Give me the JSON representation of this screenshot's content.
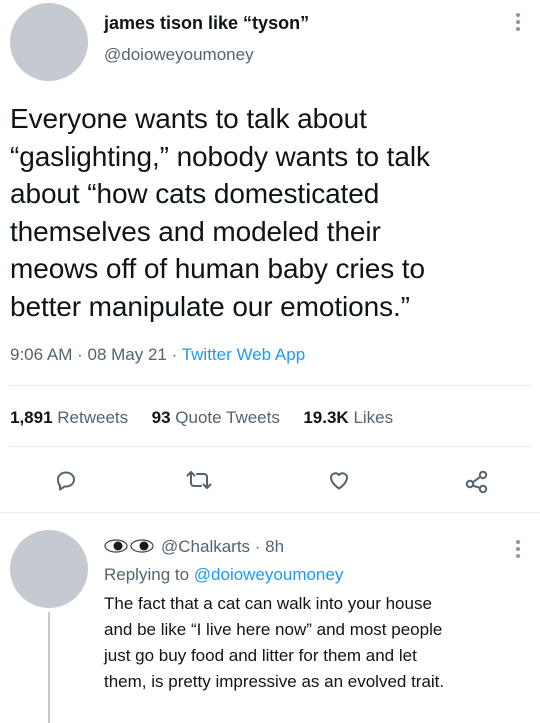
{
  "tweet": {
    "author_name": "james tison like “tyson”",
    "author_handle": "@doioweyoumoney",
    "text_lines": [
      "Everyone wants to talk about",
      "“gaslighting,” nobody wants to talk",
      "about “how cats domesticated",
      "themselves and modeled their",
      "meows off of human baby cries to",
      "better manipulate our emotions.”"
    ],
    "time": "9:06 AM",
    "date": "08 May 21",
    "app": "Twitter Web App",
    "separator": " · "
  },
  "stats": {
    "retweets_count": "1,891",
    "retweets_label": "Retweets",
    "quote_count": "93",
    "quote_label": "Quote Tweets",
    "likes_count": "19.3K",
    "likes_label": "Likes"
  },
  "actions": {
    "icons": [
      "reply-icon",
      "retweet-icon",
      "like-icon",
      "share-icon"
    ]
  },
  "reply": {
    "author_handle": "@Chalkarts",
    "age": " · 8h",
    "replying_prefix": "Replying to ",
    "replying_to": "@doioweyoumoney",
    "text_lines": [
      "The fact that a cat can walk into your house",
      "and be like “I live here now” and most people",
      "just go buy food and litter for them and let",
      "them, is pretty impressive as an evolved trait."
    ]
  },
  "colors": {
    "accent": "#1d9bf0",
    "muted": "#536471",
    "text": "#0f1419",
    "avatar": "#c5c9d0"
  }
}
